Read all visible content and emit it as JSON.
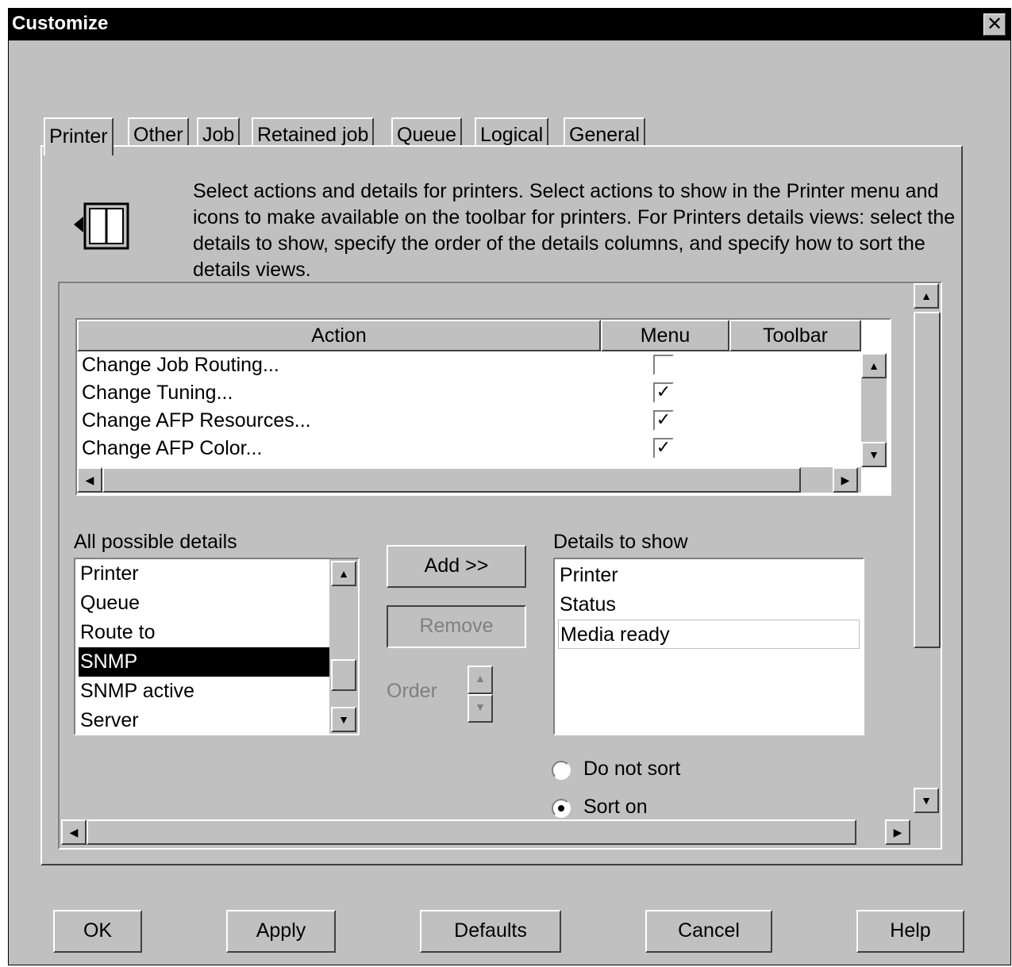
{
  "window": {
    "title": "Customize",
    "close_glyph": "✕"
  },
  "tabs": [
    {
      "label": "Printer",
      "active": true
    },
    {
      "label": "Other"
    },
    {
      "label": "Job"
    },
    {
      "label": "Retained job"
    },
    {
      "label": "Queue"
    },
    {
      "label": "Logical"
    },
    {
      "label": "General"
    }
  ],
  "description": "Select actions and details for printers.  Select actions to show in the Printer menu and icons to make available on the toolbar for printers.  For Printers details views: select the details to show, specify the order of the details columns, and specify how to sort the details views.",
  "actions_table": {
    "headers": {
      "action": "Action",
      "menu": "Menu",
      "toolbar": "Toolbar"
    },
    "rows": [
      {
        "action": "Change Job Routing...",
        "menu_checked": false
      },
      {
        "action": "Change Tuning...",
        "menu_checked": true
      },
      {
        "action": "Change AFP Resources...",
        "menu_checked": true
      },
      {
        "action": "Change AFP Color...",
        "menu_checked": true
      }
    ]
  },
  "all_details": {
    "label": "All possible details",
    "items": [
      "Printer",
      "Queue",
      "Route to",
      "SNMP",
      "SNMP active",
      "Server"
    ],
    "selected": "SNMP"
  },
  "buttons": {
    "add": "Add >>",
    "remove": "Remove",
    "order": "Order"
  },
  "details_to_show": {
    "label": "Details to show",
    "items": [
      "Printer",
      "Status",
      "Media ready"
    ]
  },
  "sort_options": {
    "do_not_sort": "Do not sort",
    "sort_on": "Sort on",
    "selected": "sort_on"
  },
  "footer": {
    "ok": "OK",
    "apply": "Apply",
    "defaults": "Defaults",
    "cancel": "Cancel",
    "help": "Help"
  }
}
